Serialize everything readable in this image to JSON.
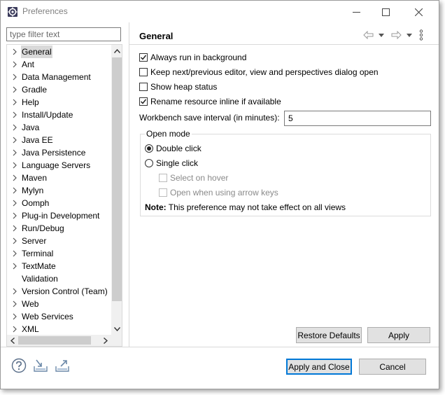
{
  "window": {
    "title": "Preferences",
    "icon": "gear-cog-icon"
  },
  "filter": {
    "placeholder": "type filter text",
    "value": ""
  },
  "tree": {
    "items": [
      {
        "label": "General",
        "selected": true,
        "expandable": true
      },
      {
        "label": "Ant",
        "expandable": true
      },
      {
        "label": "Data Management",
        "expandable": true
      },
      {
        "label": "Gradle",
        "expandable": true
      },
      {
        "label": "Help",
        "expandable": true
      },
      {
        "label": "Install/Update",
        "expandable": true
      },
      {
        "label": "Java",
        "expandable": true
      },
      {
        "label": "Java EE",
        "expandable": true
      },
      {
        "label": "Java Persistence",
        "expandable": true
      },
      {
        "label": "Language Servers",
        "expandable": true
      },
      {
        "label": "Maven",
        "expandable": true
      },
      {
        "label": "Mylyn",
        "expandable": true
      },
      {
        "label": "Oomph",
        "expandable": true
      },
      {
        "label": "Plug-in Development",
        "expandable": true
      },
      {
        "label": "Run/Debug",
        "expandable": true
      },
      {
        "label": "Server",
        "expandable": true
      },
      {
        "label": "Terminal",
        "expandable": true
      },
      {
        "label": "TextMate",
        "expandable": true
      },
      {
        "label": "Validation",
        "expandable": false
      },
      {
        "label": "Version Control (Team)",
        "expandable": true
      },
      {
        "label": "Web",
        "expandable": true
      },
      {
        "label": "Web Services",
        "expandable": true
      },
      {
        "label": "XML",
        "expandable": true
      }
    ]
  },
  "page": {
    "title": "General",
    "options": {
      "run_in_background": {
        "label": "Always run in background",
        "checked": true
      },
      "keep_next_previous": {
        "label": "Keep next/previous editor, view and perspectives dialog open",
        "checked": false
      },
      "show_heap": {
        "label": "Show heap status",
        "checked": false
      },
      "rename_inline": {
        "label": "Rename resource inline if available",
        "checked": true
      }
    },
    "save_interval": {
      "label": "Workbench save interval (in minutes):",
      "value": "5"
    },
    "open_mode": {
      "legend": "Open mode",
      "double_click": {
        "label": "Double click",
        "selected": true
      },
      "single_click": {
        "label": "Single click",
        "selected": false
      },
      "select_on_hover": {
        "label": "Select on hover",
        "checked": false,
        "enabled": false
      },
      "open_arrow_keys": {
        "label": "Open when using arrow keys",
        "checked": false,
        "enabled": false
      }
    },
    "note": {
      "bold": "Note:",
      "text": "This preference may not take effect on all views"
    },
    "restore_defaults": "Restore Defaults",
    "apply": "Apply"
  },
  "footer": {
    "apply_close": "Apply and Close",
    "cancel": "Cancel",
    "icons": [
      "help-icon",
      "import-icon",
      "export-icon"
    ]
  },
  "colors": {
    "default_button_border": "#0078d7",
    "selection": "#d9d9d9",
    "button_face": "#e1e1e1"
  }
}
